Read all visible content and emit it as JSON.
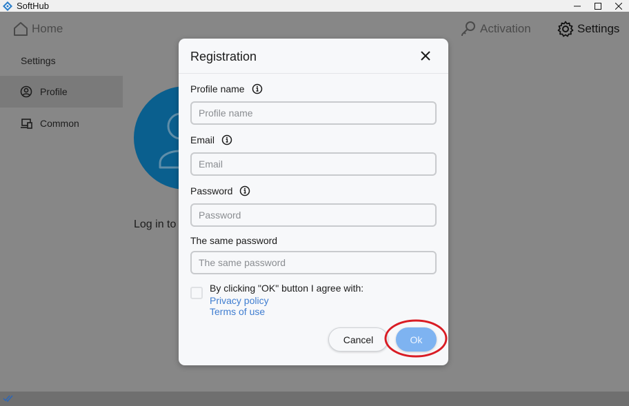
{
  "app": {
    "title": "SoftHub"
  },
  "nav": {
    "home": "Home",
    "activation": "Activation",
    "settings": "Settings"
  },
  "sidebar": {
    "heading": "Settings",
    "items": [
      {
        "label": "Profile",
        "icon": "user-circle-icon",
        "active": true
      },
      {
        "label": "Common",
        "icon": "devices-icon",
        "active": false
      }
    ]
  },
  "main": {
    "login_text": "Log in to"
  },
  "modal": {
    "title": "Registration",
    "fields": [
      {
        "label": "Profile name",
        "placeholder": "Profile name",
        "value": "",
        "has_info": true
      },
      {
        "label": "Email",
        "placeholder": "Email",
        "value": "",
        "has_info": true
      },
      {
        "label": "Password",
        "placeholder": "Password",
        "value": "",
        "has_info": true
      },
      {
        "label": "The same password",
        "placeholder": "The same password",
        "value": "",
        "has_info": false
      }
    ],
    "consent": {
      "text": "By clicking \"OK\" button I agree with:",
      "checked": false,
      "privacy_link": "Privacy policy",
      "terms_link": "Terms of use"
    },
    "buttons": {
      "cancel": "Cancel",
      "ok": "Ok"
    }
  },
  "colors": {
    "accent": "#3f7dd0",
    "ok_button": "#7eb3f1",
    "avatar": "#0a5f8e",
    "highlight_ring": "#d91c24"
  }
}
